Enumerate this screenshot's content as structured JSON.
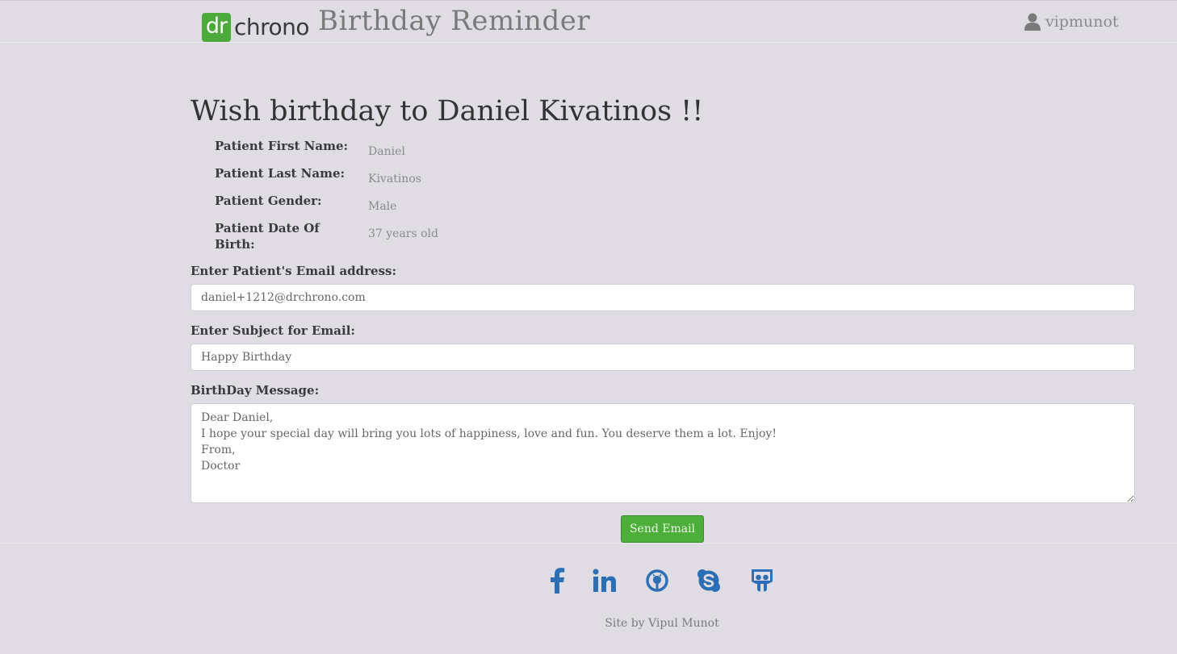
{
  "navbar": {
    "logo_dr": "dr",
    "logo_chrono": "chrono",
    "app_title": "Birthday Reminder",
    "username": "vipmunot"
  },
  "main": {
    "heading": "Wish birthday to Daniel Kivatinos !!",
    "patient_info": [
      {
        "label": "Patient First Name:",
        "value": "Daniel"
      },
      {
        "label": "Patient Last Name:",
        "value": "Kivatinos"
      },
      {
        "label": "Patient Gender:",
        "value": "Male"
      },
      {
        "label": "Patient Date Of Birth:",
        "value": "37 years old"
      }
    ],
    "email_label": "Enter Patient's Email address:",
    "email_value": "daniel+1212@drchrono.com",
    "subject_label": "Enter Subject for Email:",
    "subject_value": "Happy Birthday",
    "message_label": "BirthDay Message:",
    "message_value": "Dear Daniel,\nI hope your special day will bring you lots of happiness, love and fun. You deserve them a lot. Enjoy!\nFrom,\nDoctor",
    "send_label": "Send Email"
  },
  "footer": {
    "social_icons": [
      "facebook-icon",
      "linkedin-icon",
      "github-icon",
      "skype-icon",
      "slideshare-icon"
    ],
    "credit": "Site by Vipul Munot"
  },
  "colors": {
    "background": "#dfdde3",
    "brand_green": "#4caa3a",
    "button_green": "#4eae3a",
    "icon_blue": "#2c6fb5"
  }
}
